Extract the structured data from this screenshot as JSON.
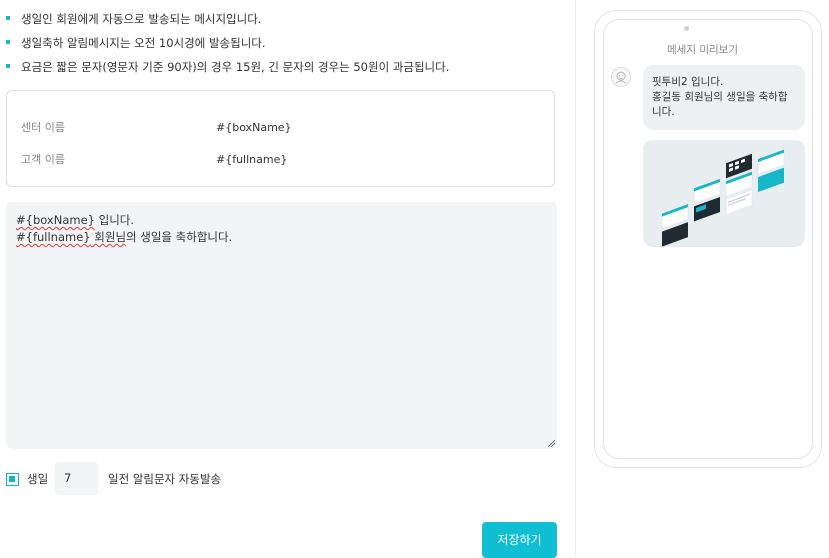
{
  "notices": [
    "생일인 회원에게 자동으로 발송되는 메시지입니다.",
    "생일축하 알림메시지는 오전 10시경에 발송됩니다.",
    "요금은 짧은 문자(영문자 기준 90자)의 경우 15원, 긴 문자의 경우는 50원이 과금됩니다."
  ],
  "variables": [
    {
      "label": "센터 이름",
      "value": "#{boxName}"
    },
    {
      "label": "고객 이름",
      "value": "#{fullname}"
    }
  ],
  "message": {
    "line1_var": "#{boxName}",
    "line1_rest": " 입니다.",
    "line2_var": "#{fullname}",
    "line2_sq": " 회원님",
    "line2_rest": "의 생일을 축하합니다."
  },
  "birthday": {
    "checkbox_label": "생일",
    "days_before": "7",
    "suffix": "일전 알림문자 자동발송"
  },
  "save_button": "저장하기",
  "preview": {
    "title": "메세지 미리보기",
    "line1": "핏투비2 입니다.",
    "line2": "홍길동 회원님의 생일을 축하합니다."
  },
  "colors": {
    "accent": "#11bfd4",
    "bullet": "#1bb8c8",
    "field_bg": "#f3f4f5",
    "bubble_bg": "#eef1f2"
  },
  "icons": [
    "bullet-square-icon",
    "resize-handle-icon",
    "checkbox-checked-icon",
    "avatar-icon"
  ]
}
